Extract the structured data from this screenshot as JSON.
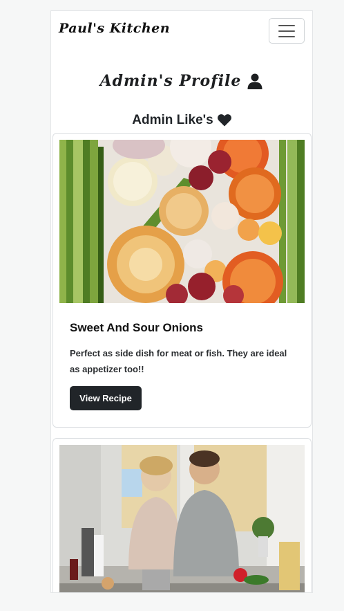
{
  "navbar": {
    "brand": "Paul's Kitchen",
    "toggler_icon": "hamburger-menu-icon"
  },
  "profile": {
    "title": "Admin's Profile",
    "title_icon": "user-icon"
  },
  "likes": {
    "title": "Admin Like's",
    "title_icon": "heart-icon"
  },
  "recipes": [
    {
      "title": "Sweet And Sour Onions",
      "description": "Perfect as side dish for meat or fish. They are ideal as appetizer too!!",
      "button_label": "View Recipe",
      "image": "onions-photo"
    },
    {
      "image": "couple-cooking-photo"
    }
  ],
  "colors": {
    "button_bg": "#212529",
    "page_bg": "#f6f7f7"
  }
}
